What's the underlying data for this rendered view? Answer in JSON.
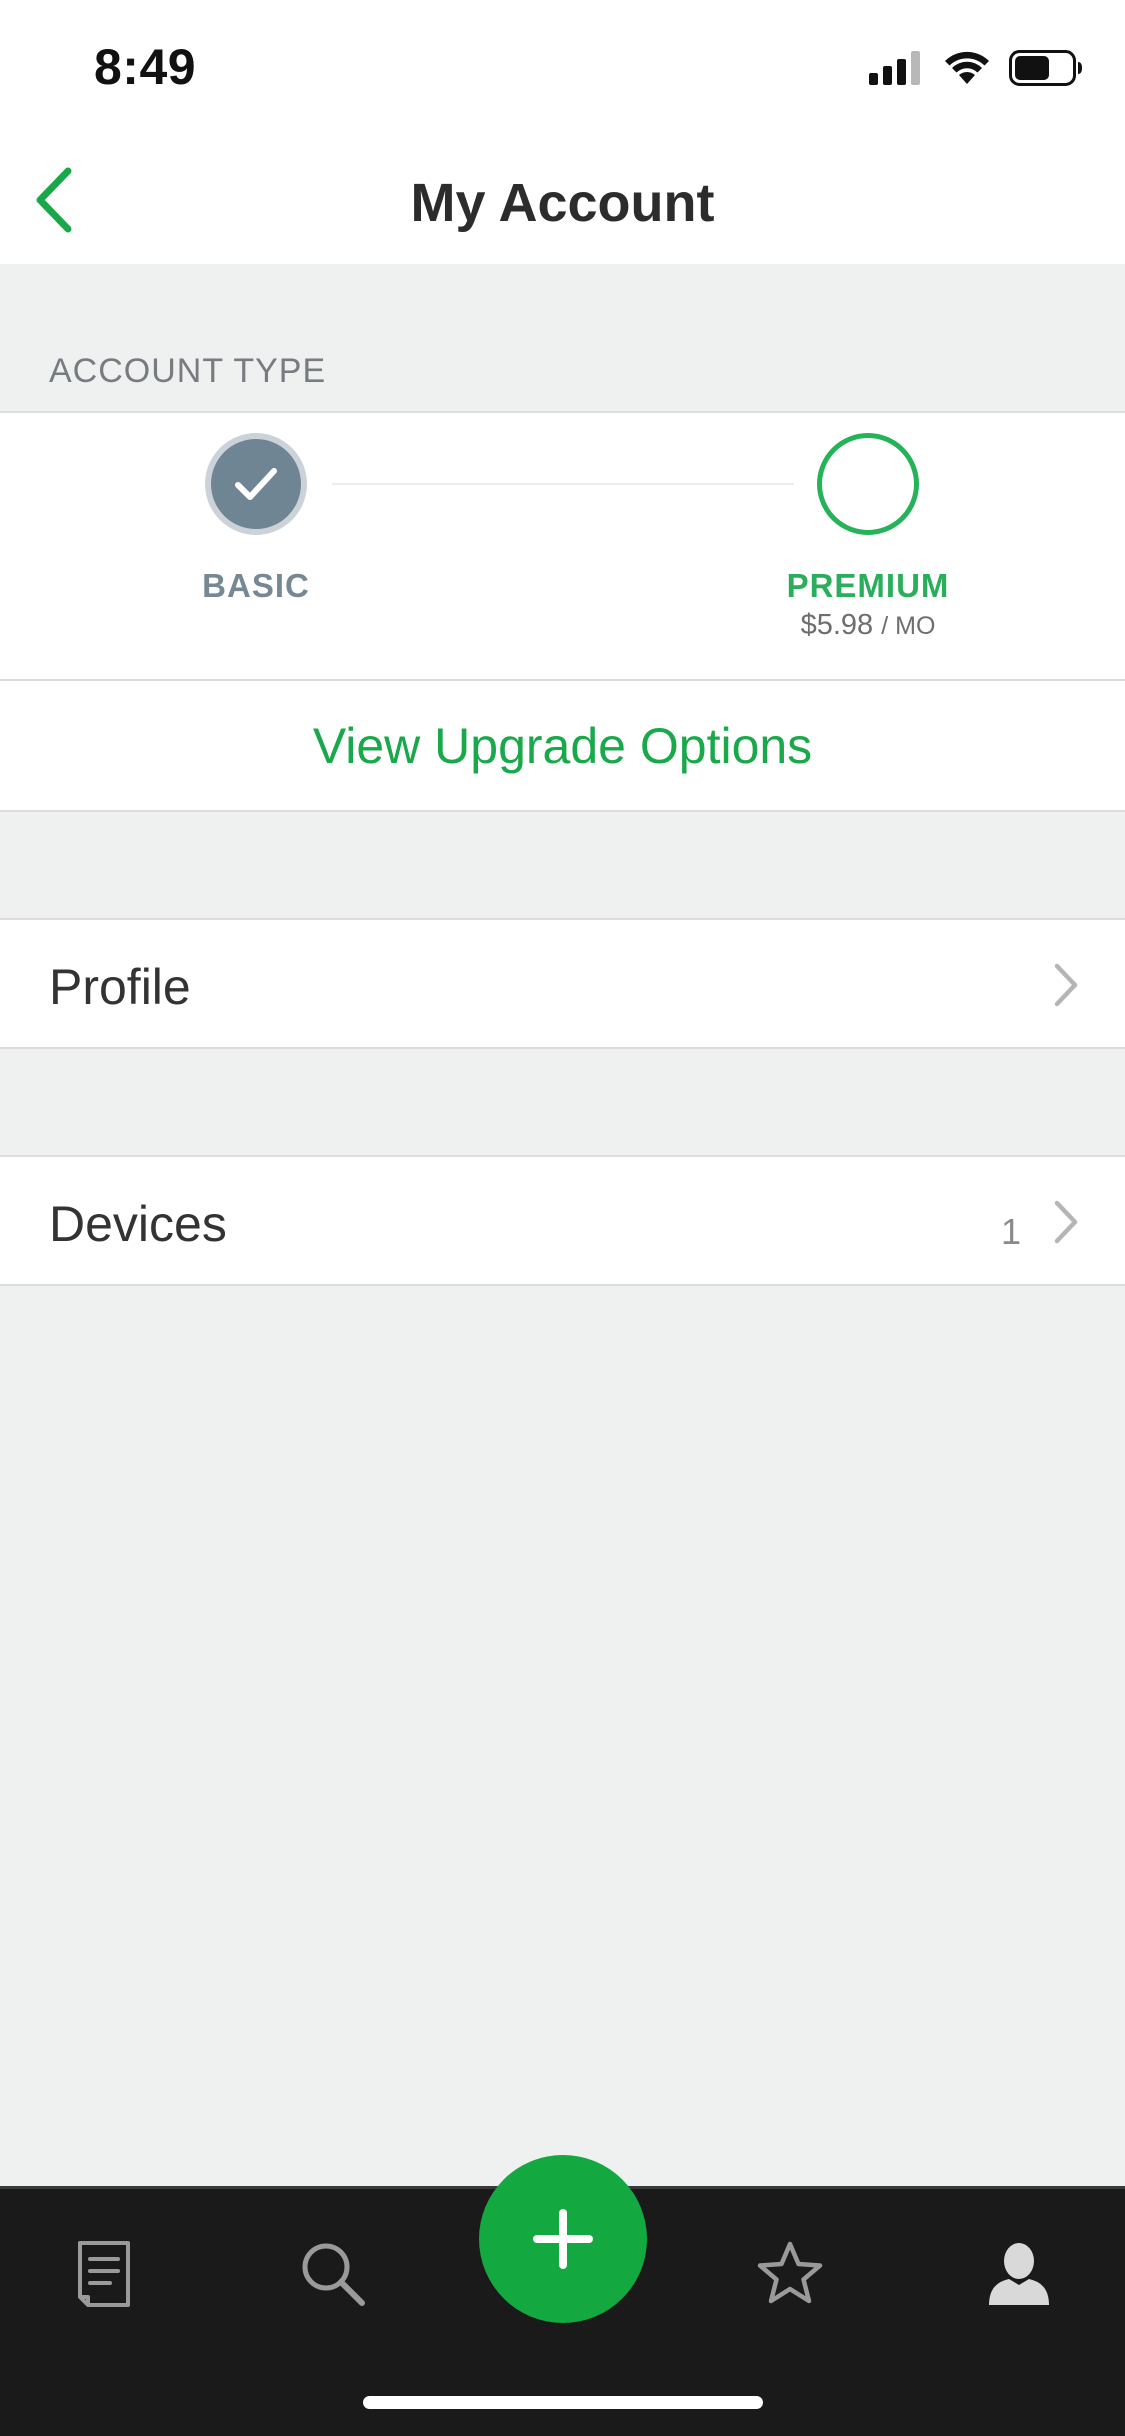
{
  "status_bar": {
    "time": "8:49"
  },
  "nav": {
    "title": "My Account"
  },
  "account_type": {
    "section_header": "ACCOUNT TYPE",
    "basic_label": "BASIC",
    "premium_label": "PREMIUM",
    "premium_price": "$5.98",
    "premium_period": "/ MO",
    "current_tier": "BASIC"
  },
  "upgrade": {
    "label": "View Upgrade Options"
  },
  "rows": {
    "profile": {
      "label": "Profile"
    },
    "devices": {
      "label": "Devices",
      "count": "1"
    }
  },
  "tab_bar": {
    "tabs": [
      "notes-icon",
      "search-icon",
      "add-icon",
      "star-icon",
      "account-icon"
    ],
    "active": "account-icon"
  },
  "colors": {
    "accent_green": "#19a84a",
    "basic_gray": "#6f8593",
    "tab_bar_bg": "#1a1a1b",
    "background": "#eff0f0"
  }
}
